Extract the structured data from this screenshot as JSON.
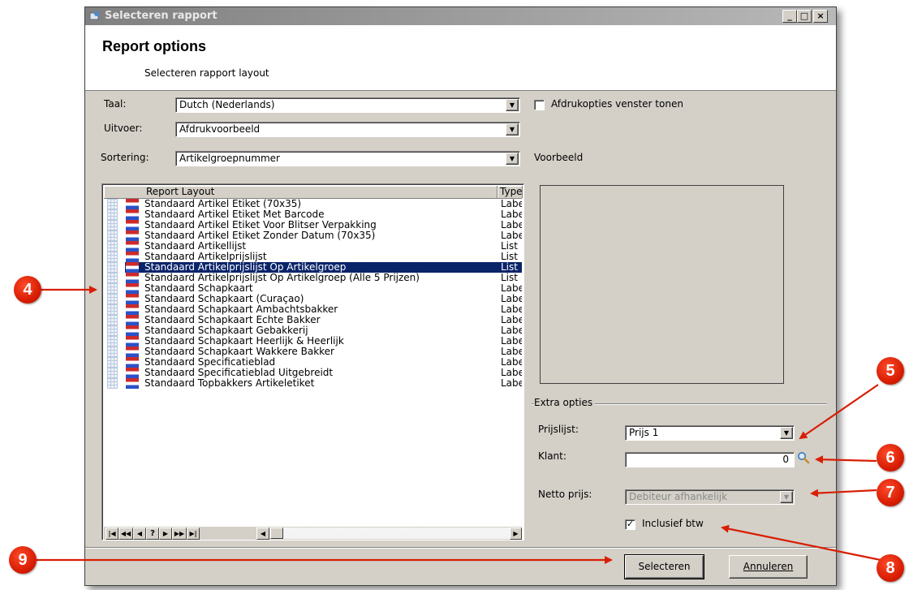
{
  "window": {
    "title": "Selecteren rapport"
  },
  "header": {
    "title": "Report options",
    "subtitle": "Selecteren rapport layout"
  },
  "form": {
    "taal": {
      "label": "Taal:",
      "value": "Dutch (Nederlands)"
    },
    "uitvoer": {
      "label": "Uitvoer:",
      "value": "Afdrukvoorbeeld"
    },
    "sortering": {
      "label": "Sortering:",
      "value": "Artikelgroepnummer"
    }
  },
  "print_options": {
    "label": "Afdrukopties venster tonen",
    "checked": false
  },
  "preview_label": "Voorbeeld",
  "list": {
    "columns": [
      "Report Layout",
      "Type"
    ],
    "rows": [
      {
        "name": "Standaard Artikel Etiket (70x35)",
        "type": "Label"
      },
      {
        "name": "Standaard Artikel Etiket Met Barcode",
        "type": "Label"
      },
      {
        "name": "Standaard Artikel Etiket Voor Blitser Verpakking",
        "type": "Label"
      },
      {
        "name": "Standaard Artikel Etiket Zonder Datum (70x35)",
        "type": "Label"
      },
      {
        "name": "Standaard Artikellijst",
        "type": "List"
      },
      {
        "name": "Standaard Artikelprijslijst",
        "type": "List"
      },
      {
        "name": "Standaard Artikelprijslijst Op Artikelgroep",
        "type": "List"
      },
      {
        "name": "Standaard Artikelprijslijst Op Artikelgroep (Alle 5 Prijzen)",
        "type": "List"
      },
      {
        "name": "Standaard Schapkaart",
        "type": "Label"
      },
      {
        "name": "Standaard Schapkaart (Curaçao)",
        "type": "Label"
      },
      {
        "name": "Standaard Schapkaart Ambachtsbakker",
        "type": "Label"
      },
      {
        "name": "Standaard Schapkaart Echte Bakker",
        "type": "Label"
      },
      {
        "name": "Standaard Schapkaart Gebakkerij",
        "type": "Label"
      },
      {
        "name": "Standaard Schapkaart Heerlijk & Heerlijk",
        "type": "Label"
      },
      {
        "name": "Standaard Schapkaart Wakkere Bakker",
        "type": "Label"
      },
      {
        "name": "Standaard Specificatieblad",
        "type": "Label"
      },
      {
        "name": "Standaard Specificatieblad Uitgebreidt",
        "type": "Label"
      },
      {
        "name": "Standaard Topbakkers Artikeletiket",
        "type": "Label"
      }
    ],
    "selected_index": 6
  },
  "extra": {
    "title": "Extra opties",
    "prijslijst": {
      "label": "Prijslijst:",
      "value": "Prijs 1"
    },
    "klant": {
      "label": "Klant:",
      "value": "0"
    },
    "netto": {
      "label": "Netto prijs:",
      "value": "Debiteur afhankelijk"
    },
    "inclusief": {
      "label": "Inclusief btw",
      "checked": true
    }
  },
  "buttons": {
    "select": "Selecteren",
    "cancel": "Annuleren"
  },
  "annotations": [
    "4",
    "5",
    "6",
    "7",
    "8",
    "9"
  ],
  "colors": {
    "selection": "#0a246a",
    "annotation": "#d81e04",
    "dialog_bg": "#d4d0c8"
  }
}
